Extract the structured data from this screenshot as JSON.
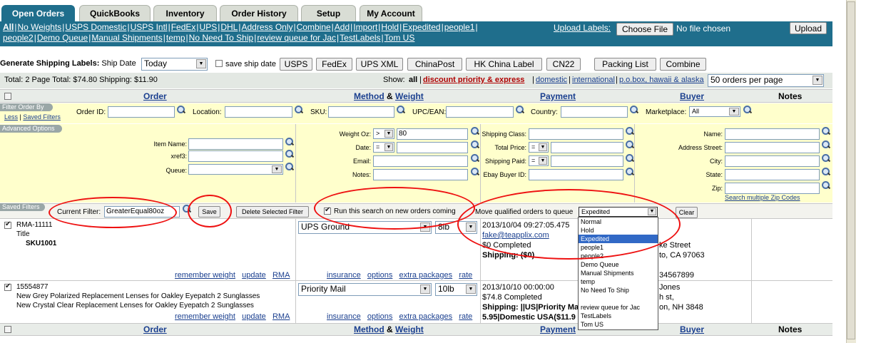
{
  "tabs": [
    {
      "label": "Open Orders",
      "active": true
    },
    {
      "label": "QuickBooks"
    },
    {
      "label": "Inventory"
    },
    {
      "label": "Order History"
    },
    {
      "label": "Setup"
    },
    {
      "label": "My Account"
    }
  ],
  "nav": {
    "links": [
      "All",
      "No Weights",
      "USPS Domestic",
      "USPS Intl",
      "FedEx",
      "UPS",
      "DHL",
      "Address Only",
      "Combine",
      "Add",
      "Import",
      "Hold",
      "Expedited",
      "people1",
      "people2",
      "Demo Queue",
      "Manual Shipments",
      "temp",
      "No Need To Ship",
      "review queue for Jac",
      "TestLabels",
      "Tom US"
    ],
    "upload_labels": "Upload Labels:",
    "choose_file": "Choose File",
    "no_file": "No file chosen",
    "upload": "Upload"
  },
  "shipbar": {
    "title": "Generate Shipping Labels:",
    "ship_date_label": "Ship Date",
    "ship_date_value": "Today",
    "save_ship_date": "save ship date",
    "buttons": [
      "USPS",
      "FedEx",
      "UPS XML",
      "ChinaPost",
      "HK China Label",
      "CN22"
    ],
    "packing_list": "Packing List",
    "combine": "Combine"
  },
  "totals": {
    "text": "Total:  2  Page Total: $74.80  Shipping: $11.90",
    "show_label": "Show:",
    "show_all": "all",
    "show_discount": "discount priority & express",
    "show_links": [
      "domestic",
      "international",
      "p.o.box, hawaii & alaska"
    ],
    "per_page": "50 orders per page"
  },
  "columns": {
    "order": "Order",
    "method": "Method",
    "amp": "&",
    "weight": "Weight",
    "payment": "Payment",
    "buyer": "Buyer",
    "notes": "Notes"
  },
  "filter": {
    "title": "Filter Order By",
    "less": "Less",
    "saved_filters": "Saved Filters",
    "order_id": "Order ID:",
    "location": "Location:",
    "sku": "SKU:",
    "upc": "UPC/EAN:",
    "country": "Country:",
    "marketplace": "Marketplace:",
    "marketplace_value": "All"
  },
  "advanced": {
    "title": "Advanced Options",
    "item_name": "Item Name:",
    "xref3": "xref3:",
    "queue": "Queue:",
    "weight_oz": "Weight Oz:",
    "weight_op": ">",
    "weight_val": "80",
    "date": "Date:",
    "date_op": "=",
    "email": "Email:",
    "notes": "Notes:",
    "shipping_class": "Shipping Class:",
    "total_price": "Total Price:",
    "total_op": "=",
    "shipping_paid": "Shipping Paid:",
    "paid_op": "=",
    "ebay_buyer": "Ebay Buyer ID:",
    "name": "Name:",
    "address": "Address Street:",
    "city": "City:",
    "state": "State:",
    "zip": "Zip:",
    "search_zip": "Search multiple Zip Codes"
  },
  "saved": {
    "title": "Saved Filters",
    "current_filter": "Current Filter:",
    "current_value": "GreaterEqual80oz",
    "save": "Save",
    "delete": "Delete Selected Filter",
    "run_label": "Run this search on new orders coming",
    "move_label": "Move qualified orders to queue",
    "queue_value": "Expedited",
    "clear": "Clear"
  },
  "queue_options": [
    "Normal",
    "Hold",
    "Expedited",
    "people1",
    "people2",
    "Demo Queue",
    "Manual Shipments",
    "temp",
    "No Need To Ship",
    "",
    "review queue for Jac",
    "TestLabels",
    "Tom US"
  ],
  "orders": [
    {
      "order_id": "RMA-11111",
      "title": "Title",
      "sku": "SKU1001",
      "method": "UPS Ground",
      "weight": "8lb",
      "date": "2013/10/04 09:27:05.475",
      "email": "fake@teapplix.com",
      "completed": "$0 Completed",
      "shipping": "Shipping: ($0)",
      "buyer_street": "ke Street",
      "buyer_city": "to, CA 97063",
      "buyer_phone": "34567899"
    },
    {
      "order_id": "15554877",
      "title": "New Grey Polarized Replacement Lenses for Oakley Eyepatch 2 Sunglasses",
      "title2": "New Crystal Clear Replacement Lenses for Oakley Eyepatch 2 Sunglasses",
      "method": "Priority Mail",
      "weight": "10lb",
      "date": "2013/10/10 00:00:00",
      "completed": "$74.8 Completed",
      "shipping": "Shipping: ||US|Priority Ma",
      "shipping2": "5.95|Domestic USA($11.9",
      "buyer_name": "Jones",
      "buyer_street": "h st,",
      "buyer_city": "on, NH 3848"
    }
  ],
  "row_links": {
    "remember": "remember weight",
    "update": "update",
    "rma": "RMA",
    "insurance": "insurance",
    "options": "options",
    "extra": "extra packages",
    "rate": "rate"
  },
  "colors": {
    "teal": "#1f6e8c",
    "header_bg": "#e8ece8",
    "yellow": "#ffffcc",
    "annotation": "#e11111"
  }
}
